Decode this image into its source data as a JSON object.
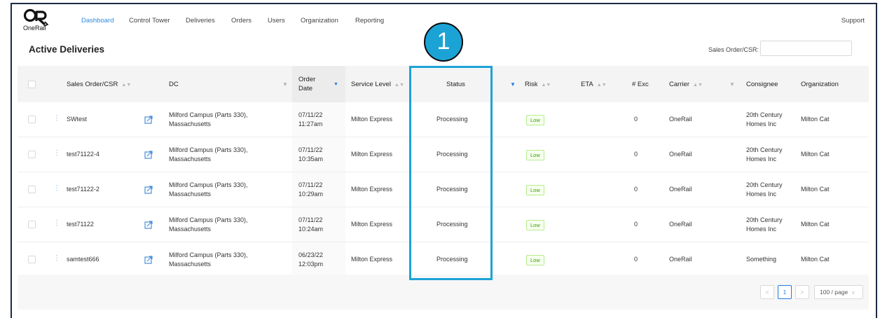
{
  "brand": {
    "logo_text": "OneRail"
  },
  "nav": {
    "items": [
      "Dashboard",
      "Control Tower",
      "Deliveries",
      "Orders",
      "Users",
      "Organization",
      "Reporting"
    ],
    "active": "Dashboard",
    "support": "Support"
  },
  "page": {
    "title": "Active Deliveries",
    "search_label": "Sales Order/CSR:",
    "search_value": ""
  },
  "table": {
    "headers": {
      "sales_order": "Sales Order/CSR",
      "dc": "DC",
      "order_date_1": "Order",
      "order_date_2": "Date",
      "service_level": "Service Level",
      "status": "Status",
      "risk": "Risk",
      "eta": "ETA",
      "exc": "# Exc",
      "carrier": "Carrier",
      "consignee": "Consignee",
      "organization": "Organization"
    },
    "rows": [
      {
        "order": "SWtest",
        "dc1": "Milford Campus (Parts 330),",
        "dc2": "Massachusetts",
        "date": "07/11/22",
        "time": "11:27am",
        "service": "Milton Express",
        "status": "Processing",
        "risk": "Low",
        "eta": "",
        "exc": "0",
        "carrier": "OneRail",
        "consignee1": "20th Century",
        "consignee2": "Homes Inc",
        "org": "Milton Cat"
      },
      {
        "order": "test71122-4",
        "dc1": "Milford Campus (Parts 330),",
        "dc2": "Massachusetts",
        "date": "07/11/22",
        "time": "10:35am",
        "service": "Milton Express",
        "status": "Processing",
        "risk": "Low",
        "eta": "",
        "exc": "0",
        "carrier": "OneRail",
        "consignee1": "20th Century",
        "consignee2": "Homes Inc",
        "org": "Milton Cat"
      },
      {
        "order": "test71122-2",
        "dc1": "Milford Campus (Parts 330),",
        "dc2": "Massachusetts",
        "date": "07/11/22",
        "time": "10:29am",
        "service": "Milton Express",
        "status": "Processing",
        "risk": "Low",
        "eta": "",
        "exc": "0",
        "carrier": "OneRail",
        "consignee1": "20th Century",
        "consignee2": "Homes Inc",
        "org": "Milton Cat"
      },
      {
        "order": "test71122",
        "dc1": "Milford Campus (Parts 330),",
        "dc2": "Massachusetts",
        "date": "07/11/22",
        "time": "10:24am",
        "service": "Milton Express",
        "status": "Processing",
        "risk": "Low",
        "eta": "",
        "exc": "0",
        "carrier": "OneRail",
        "consignee1": "20th Century",
        "consignee2": "Homes Inc",
        "org": "Milton Cat"
      },
      {
        "order": "samtest666",
        "dc1": "Milford Campus (Parts 330),",
        "dc2": "Massachusetts",
        "date": "06/23/22",
        "time": "12:03pm",
        "service": "Milton Express",
        "status": "Processing",
        "risk": "Low",
        "eta": "",
        "exc": "0",
        "carrier": "OneRail",
        "consignee1": "Something",
        "consignee2": "",
        "org": "Milton Cat"
      }
    ]
  },
  "pagination": {
    "prev": "<",
    "current_page": "1",
    "next": ">",
    "page_size": "100 / page"
  },
  "annotation": {
    "callout_number": "1"
  },
  "colors": {
    "accent": "#2a8bdc",
    "highlight": "#1ca3d6",
    "risk_low_bg": "#f6ffed",
    "risk_low_text": "#389e0d"
  },
  "icons": [
    "onerail-logo",
    "sort-icon",
    "filter-icon",
    "more-vertical-icon",
    "open-external-icon",
    "chevron-left-icon",
    "chevron-right-icon",
    "chevron-down-icon"
  ]
}
